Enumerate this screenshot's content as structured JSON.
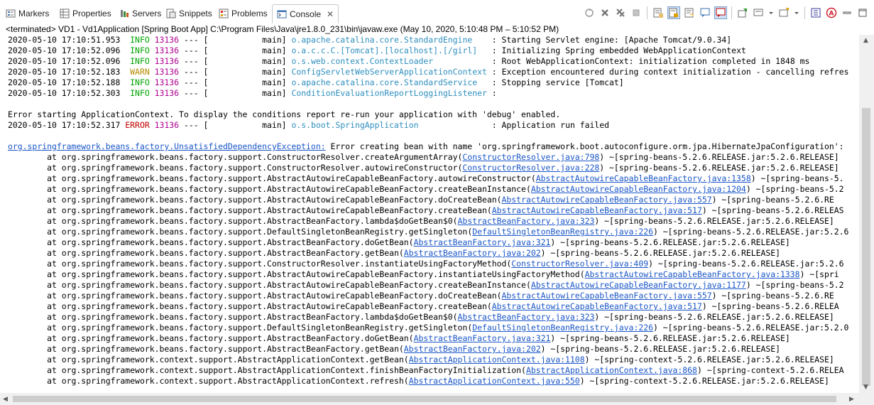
{
  "tabs": [
    {
      "label": "Markers",
      "icon": "markers-icon"
    },
    {
      "label": "Properties",
      "icon": "properties-icon"
    },
    {
      "label": "Servers",
      "icon": "servers-icon"
    },
    {
      "label": "Snippets",
      "icon": "snippets-icon"
    },
    {
      "label": "Problems",
      "icon": "problems-icon"
    },
    {
      "label": "Console",
      "icon": "console-icon",
      "active": true
    }
  ],
  "toolbar": {
    "icons": [
      "pin-console-icon",
      "remove-launch-icon",
      "remove-all-icon",
      "terminate-icon",
      "clear-console-icon",
      "scroll-lock-icon",
      "word-wrap-icon",
      "show-on-stdout-icon",
      "show-on-stderr-icon",
      "open-console-icon",
      "display-selected-console-icon",
      "new-console-icon",
      "view-menu-icon",
      "minimize-icon",
      "maximize-icon"
    ]
  },
  "status": {
    "text": "<terminated> VD1 - Vd1Application [Spring Boot App] C:\\Program Files\\Java\\jre1.8.0_231\\bin\\javaw.exe  (May 10, 2020, 5:10:48 PM – 5:10:52 PM)"
  },
  "colors": {
    "info": "#00a500",
    "warn": "#b58c00",
    "error": "#c00000",
    "pid": "#b00090",
    "logger": "#2e8fbf",
    "link": "#1a56c8"
  },
  "log_lines": [
    {
      "ts": "2020-05-10 17:10:51.953",
      "level": "INFO",
      "pid": "13136",
      "thread": "main",
      "logger": "o.apache.catalina.core.StandardEngine",
      "msg": "Starting Servlet engine: [Apache Tomcat/9.0.34]"
    },
    {
      "ts": "2020-05-10 17:10:52.096",
      "level": "INFO",
      "pid": "13136",
      "thread": "main",
      "logger": "o.a.c.c.C.[Tomcat].[localhost].[/girl]",
      "msg": "Initializing Spring embedded WebApplicationContext"
    },
    {
      "ts": "2020-05-10 17:10:52.096",
      "level": "INFO",
      "pid": "13136",
      "thread": "main",
      "logger": "o.s.web.context.ContextLoader",
      "msg": "Root WebApplicationContext: initialization completed in 1848 ms"
    },
    {
      "ts": "2020-05-10 17:10:52.183",
      "level": "WARN",
      "pid": "13136",
      "thread": "main",
      "logger": "ConfigServletWebServerApplicationContext",
      "msg": "Exception encountered during context initialization - cancelling refres"
    },
    {
      "ts": "2020-05-10 17:10:52.188",
      "level": "INFO",
      "pid": "13136",
      "thread": "main",
      "logger": "o.apache.catalina.core.StandardService",
      "msg": "Stopping service [Tomcat]"
    },
    {
      "ts": "2020-05-10 17:10:52.303",
      "level": "INFO",
      "pid": "13136",
      "thread": "main",
      "logger": "ConditionEvaluationReportLoggingListener",
      "msg": ""
    }
  ],
  "error_notice": "Error starting ApplicationContext. To display the conditions report re-run your application with 'debug' enabled.",
  "error_line": {
    "ts": "2020-05-10 17:10:52.317",
    "level": "ERROR",
    "pid": "13136",
    "thread": "main",
    "logger": "o.s.boot.SpringApplication",
    "msg": "Application run failed"
  },
  "exception": {
    "class": "org.springframework.beans.factory.UnsatisfiedDependencyException:",
    "msg": " Error creating bean with name 'org.springframework.boot.autoconfigure.orm.jpa.HibernateJpaConfiguration':"
  },
  "stack": [
    {
      "method": "org.springframework.beans.factory.support.ConstructorResolver.createArgumentArray",
      "src": "ConstructorResolver.java:798",
      "jar": " ~[spring-beans-5.2.6.RELEASE.jar:5.2.6.RELEASE]"
    },
    {
      "method": "org.springframework.beans.factory.support.ConstructorResolver.autowireConstructor",
      "src": "ConstructorResolver.java:228",
      "jar": " ~[spring-beans-5.2.6.RELEASE.jar:5.2.6.RELEASE]"
    },
    {
      "method": "org.springframework.beans.factory.support.AbstractAutowireCapableBeanFactory.autowireConstructor",
      "src": "AbstractAutowireCapableBeanFactory.java:1358",
      "jar": " ~[spring-beans-5."
    },
    {
      "method": "org.springframework.beans.factory.support.AbstractAutowireCapableBeanFactory.createBeanInstance",
      "src": "AbstractAutowireCapableBeanFactory.java:1204",
      "jar": " ~[spring-beans-5.2"
    },
    {
      "method": "org.springframework.beans.factory.support.AbstractAutowireCapableBeanFactory.doCreateBean",
      "src": "AbstractAutowireCapableBeanFactory.java:557",
      "jar": " ~[spring-beans-5.2.6.RE"
    },
    {
      "method": "org.springframework.beans.factory.support.AbstractAutowireCapableBeanFactory.createBean",
      "src": "AbstractAutowireCapableBeanFactory.java:517",
      "jar": " ~[spring-beans-5.2.6.RELEAS"
    },
    {
      "method": "org.springframework.beans.factory.support.AbstractBeanFactory.lambda$doGetBean$0",
      "src": "AbstractBeanFactory.java:323",
      "jar": " ~[spring-beans-5.2.6.RELEASE.jar:5.2.6.RELEASE]"
    },
    {
      "method": "org.springframework.beans.factory.support.DefaultSingletonBeanRegistry.getSingleton",
      "src": "DefaultSingletonBeanRegistry.java:226",
      "jar": " ~[spring-beans-5.2.6.RELEASE.jar:5.2.6"
    },
    {
      "method": "org.springframework.beans.factory.support.AbstractBeanFactory.doGetBean",
      "src": "AbstractBeanFactory.java:321",
      "jar": " ~[spring-beans-5.2.6.RELEASE.jar:5.2.6.RELEASE]"
    },
    {
      "method": "org.springframework.beans.factory.support.AbstractBeanFactory.getBean",
      "src": "AbstractBeanFactory.java:202",
      "jar": " ~[spring-beans-5.2.6.RELEASE.jar:5.2.6.RELEASE]"
    },
    {
      "method": "org.springframework.beans.factory.support.ConstructorResolver.instantiateUsingFactoryMethod",
      "src": "ConstructorResolver.java:409",
      "jar": " ~[spring-beans-5.2.6.RELEASE.jar:5.2.6"
    },
    {
      "method": "org.springframework.beans.factory.support.AbstractAutowireCapableBeanFactory.instantiateUsingFactoryMethod",
      "src": "AbstractAutowireCapableBeanFactory.java:1338",
      "jar": " ~[spri"
    },
    {
      "method": "org.springframework.beans.factory.support.AbstractAutowireCapableBeanFactory.createBeanInstance",
      "src": "AbstractAutowireCapableBeanFactory.java:1177",
      "jar": " ~[spring-beans-5.2"
    },
    {
      "method": "org.springframework.beans.factory.support.AbstractAutowireCapableBeanFactory.doCreateBean",
      "src": "AbstractAutowireCapableBeanFactory.java:557",
      "jar": " ~[spring-beans-5.2.6.RE"
    },
    {
      "method": "org.springframework.beans.factory.support.AbstractAutowireCapableBeanFactory.createBean",
      "src": "AbstractAutowireCapableBeanFactory.java:517",
      "jar": " ~[spring-beans-5.2.6.RELEA"
    },
    {
      "method": "org.springframework.beans.factory.support.AbstractBeanFactory.lambda$doGetBean$0",
      "src": "AbstractBeanFactory.java:323",
      "jar": " ~[spring-beans-5.2.6.RELEASE.jar:5.2.6.RELEASE]"
    },
    {
      "method": "org.springframework.beans.factory.support.DefaultSingletonBeanRegistry.getSingleton",
      "src": "DefaultSingletonBeanRegistry.java:226",
      "jar": " ~[spring-beans-5.2.6.RELEASE.jar:5.2.0"
    },
    {
      "method": "org.springframework.beans.factory.support.AbstractBeanFactory.doGetBean",
      "src": "AbstractBeanFactory.java:321",
      "jar": " ~[spring-beans-5.2.6.RELEASE.jar:5.2.6.RELEASE]"
    },
    {
      "method": "org.springframework.beans.factory.support.AbstractBeanFactory.getBean",
      "src": "AbstractBeanFactory.java:202",
      "jar": " ~[spring-beans-5.2.6.RELEASE.jar:5.2.6.RELEASE]"
    },
    {
      "method": "org.springframework.context.support.AbstractApplicationContext.getBean",
      "src": "AbstractApplicationContext.java:1108",
      "jar": " ~[spring-context-5.2.6.RELEASE.jar:5.2.6.RELEASE]"
    },
    {
      "method": "org.springframework.context.support.AbstractApplicationContext.finishBeanFactoryInitialization",
      "src": "AbstractApplicationContext.java:868",
      "jar": " ~[spring-context-5.2.6.RELEA"
    },
    {
      "method": "org.springframework.context.support.AbstractApplicationContext.refresh",
      "src": "AbstractApplicationContext.java:550",
      "jar": " ~[spring-context-5.2.6.RELEASE.jar:5.2.6.RELEASE]"
    }
  ]
}
